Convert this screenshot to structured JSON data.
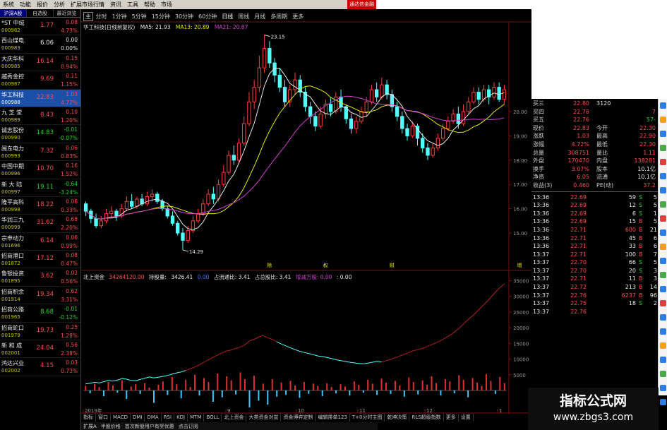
{
  "menu": {
    "items": [
      "系统",
      "功能",
      "报价",
      "分析",
      "扩展市场行情",
      "资讯",
      "工具",
      "帮助",
      "市场"
    ],
    "right_label": "通达信金融"
  },
  "stock_list": {
    "tabs": [
      "沪深A股",
      "自选股",
      "最近浏览"
    ],
    "rows": [
      {
        "name": "*ST 中绒",
        "code": "000982",
        "price": "1.77",
        "change": "0.08",
        "pct": "4.73%",
        "color": "red"
      },
      {
        "name": "西山煤电",
        "code": "000983",
        "price": "6.06",
        "change": "0.00",
        "pct": "0.00%",
        "color": "white"
      },
      {
        "name": "大庆华科",
        "code": "000985",
        "price": "16.14",
        "change": "0.15",
        "pct": "0.94%",
        "color": "red"
      },
      {
        "name": "越秀金控",
        "code": "000987",
        "price": "9.69",
        "change": "0.11",
        "pct": "1.15%",
        "color": "red"
      },
      {
        "name": "华工科技",
        "code": "000988",
        "price": "22.83",
        "change": "1.03",
        "pct": "4.72%",
        "color": "red",
        "selected": true
      },
      {
        "name": "九 芝 堂",
        "code": "000989",
        "price": "8.43",
        "change": "0.10",
        "pct": "1.20%",
        "color": "red"
      },
      {
        "name": "诚志股份",
        "code": "000990",
        "price": "14.83",
        "change": "-0.01",
        "pct": "-0.07%",
        "color": "green"
      },
      {
        "name": "闽东电力",
        "code": "000993",
        "price": "7.32",
        "change": "0.06",
        "pct": "0.83%",
        "color": "red"
      },
      {
        "name": "中国中期",
        "code": "000996",
        "price": "10.70",
        "change": "0.16",
        "pct": "1.52%",
        "color": "red"
      },
      {
        "name": "新 大 陆",
        "code": "000997",
        "price": "19.11",
        "change": "-0.64",
        "pct": "-3.24%",
        "color": "green"
      },
      {
        "name": "隆平高科",
        "code": "000998",
        "price": "18.22",
        "change": "0.06",
        "pct": "0.33%",
        "color": "red"
      },
      {
        "name": "华润三九",
        "code": "000999",
        "price": "31.62",
        "change": "0.68",
        "pct": "2.20%",
        "color": "red"
      },
      {
        "name": "宗申动力",
        "code": "001696",
        "price": "6.14",
        "change": "0.06",
        "pct": "0.99%",
        "color": "red"
      },
      {
        "name": "招商港口",
        "code": "001872",
        "price": "17.12",
        "change": "0.08",
        "pct": "0.47%",
        "color": "red"
      },
      {
        "name": "鲁银投资",
        "code": "001895",
        "price": "3.62",
        "change": "0.02",
        "pct": "0.56%",
        "color": "red"
      },
      {
        "name": "招商积余",
        "code": "001914",
        "price": "19.34",
        "change": "0.62",
        "pct": "3.31%",
        "color": "red"
      },
      {
        "name": "招商公路",
        "code": "001965",
        "price": "8.68",
        "change": "-0.01",
        "pct": "-0.12%",
        "color": "green"
      },
      {
        "name": "招商蛇口",
        "code": "001979",
        "price": "19.73",
        "change": "0.25",
        "pct": "1.28%",
        "color": "red"
      },
      {
        "name": "新 和 成",
        "code": "002001",
        "price": "24.04",
        "change": "0.56",
        "pct": "2.38%",
        "color": "red"
      },
      {
        "name": "鸿达兴业",
        "code": "002002",
        "price": "4.15",
        "change": "0.03",
        "pct": "0.73%",
        "color": "red"
      }
    ]
  },
  "period_bar": {
    "items": [
      "分时",
      "1分钟",
      "5分钟",
      "15分钟",
      "30分钟",
      "60分钟",
      "日线",
      "周线",
      "月线",
      "多周期",
      "更多"
    ],
    "box_label": "主"
  },
  "chart_header": {
    "name": "华工科技(日线前复权)",
    "ma5": "MA5: 21.93",
    "ma13": "MA13: 20.89",
    "ma21": "MA21: 20.87"
  },
  "vol_header": {
    "name": "北上资金",
    "v1": "34264120.00",
    "v2label": "持股量:",
    "v2": "3426.41",
    "v3": "0.00",
    "v4": "占流通比: 3.41",
    "v5": "占总股比: 3.41",
    "v6": "增减万股: 0.00",
    "v7": ": 0.00"
  },
  "chart_data": {
    "type": "candlestick",
    "y_ticks": [
      "20.00",
      "19.00",
      "18.00",
      "17.00",
      "16.00",
      "15.00"
    ],
    "vol_ticks": [
      "35000",
      "30000",
      "25000",
      "20000",
      "15000",
      "10000",
      "5000"
    ],
    "annotations": [
      "23.15",
      "14.29"
    ],
    "markers": [
      "除",
      "权",
      "财",
      "增"
    ],
    "x_labels": [
      "2019年",
      "9",
      "10",
      "11",
      "12",
      "1"
    ],
    "candles": [
      {
        "o": 16.2,
        "c": 15.9,
        "h": 16.3,
        "l": 15.7
      },
      {
        "o": 15.9,
        "c": 15.6,
        "h": 16.0,
        "l": 15.4
      },
      {
        "o": 15.6,
        "c": 15.3,
        "h": 15.8,
        "l": 15.2
      },
      {
        "o": 15.3,
        "c": 15.5,
        "h": 15.7,
        "l": 15.2
      },
      {
        "o": 15.5,
        "c": 15.8,
        "h": 16.0,
        "l": 15.4
      },
      {
        "o": 15.8,
        "c": 15.9,
        "h": 16.1,
        "l": 15.6
      },
      {
        "o": 15.9,
        "c": 15.7,
        "h": 16.0,
        "l": 15.5
      },
      {
        "o": 15.7,
        "c": 16.0,
        "h": 16.2,
        "l": 15.6
      },
      {
        "o": 16.0,
        "c": 16.3,
        "h": 16.5,
        "l": 15.9
      },
      {
        "o": 16.3,
        "c": 16.1,
        "h": 16.6,
        "l": 16.0
      },
      {
        "o": 16.1,
        "c": 16.4,
        "h": 16.5,
        "l": 16.0
      },
      {
        "o": 16.4,
        "c": 16.2,
        "h": 16.6,
        "l": 16.1
      },
      {
        "o": 16.2,
        "c": 16.5,
        "h": 16.7,
        "l": 16.1
      },
      {
        "o": 16.5,
        "c": 16.6,
        "h": 16.8,
        "l": 16.3
      },
      {
        "o": 16.6,
        "c": 16.3,
        "h": 16.7,
        "l": 16.2
      },
      {
        "o": 16.3,
        "c": 16.0,
        "h": 16.4,
        "l": 15.9
      },
      {
        "o": 16.0,
        "c": 15.7,
        "h": 16.1,
        "l": 15.6
      },
      {
        "o": 15.7,
        "c": 15.4,
        "h": 15.9,
        "l": 15.3
      },
      {
        "o": 15.4,
        "c": 15.0,
        "h": 15.5,
        "l": 14.9
      },
      {
        "o": 15.0,
        "c": 14.7,
        "h": 15.2,
        "l": 14.3
      },
      {
        "o": 14.7,
        "c": 15.1,
        "h": 15.3,
        "l": 14.6
      },
      {
        "o": 15.1,
        "c": 15.5,
        "h": 15.7,
        "l": 15.0
      },
      {
        "o": 15.5,
        "c": 15.8,
        "h": 16.0,
        "l": 15.4
      },
      {
        "o": 15.8,
        "c": 16.2,
        "h": 16.4,
        "l": 15.7
      },
      {
        "o": 16.2,
        "c": 16.6,
        "h": 16.8,
        "l": 16.1
      },
      {
        "o": 16.6,
        "c": 16.4,
        "h": 16.9,
        "l": 16.2
      },
      {
        "o": 16.4,
        "c": 17.0,
        "h": 17.2,
        "l": 16.3
      },
      {
        "o": 17.0,
        "c": 17.5,
        "h": 17.8,
        "l": 16.9
      },
      {
        "o": 17.5,
        "c": 18.2,
        "h": 18.4,
        "l": 17.4
      },
      {
        "o": 18.2,
        "c": 18.0,
        "h": 18.6,
        "l": 17.8
      },
      {
        "o": 18.0,
        "c": 18.7,
        "h": 18.9,
        "l": 17.9
      },
      {
        "o": 18.7,
        "c": 19.5,
        "h": 19.8,
        "l": 18.6
      },
      {
        "o": 19.5,
        "c": 20.4,
        "h": 20.8,
        "l": 19.4
      },
      {
        "o": 20.4,
        "c": 21.0,
        "h": 21.3,
        "l": 20.1
      },
      {
        "o": 21.0,
        "c": 21.8,
        "h": 22.3,
        "l": 20.8
      },
      {
        "o": 21.8,
        "c": 22.6,
        "h": 23.15,
        "l": 21.6
      },
      {
        "o": 22.6,
        "c": 22.0,
        "h": 22.9,
        "l": 21.8
      },
      {
        "o": 22.0,
        "c": 21.5,
        "h": 22.2,
        "l": 21.2
      },
      {
        "o": 21.5,
        "c": 21.0,
        "h": 21.8,
        "l": 20.8
      },
      {
        "o": 21.0,
        "c": 20.4,
        "h": 21.3,
        "l": 20.2
      },
      {
        "o": 20.4,
        "c": 20.9,
        "h": 21.1,
        "l": 20.2
      },
      {
        "o": 20.9,
        "c": 21.3,
        "h": 21.6,
        "l": 20.7
      },
      {
        "o": 21.3,
        "c": 20.8,
        "h": 21.5,
        "l": 20.6
      },
      {
        "o": 20.8,
        "c": 20.2,
        "h": 21.0,
        "l": 20.0
      },
      {
        "o": 20.2,
        "c": 19.8,
        "h": 20.4,
        "l": 19.5
      },
      {
        "o": 19.8,
        "c": 19.4,
        "h": 20.0,
        "l": 19.2
      },
      {
        "o": 19.4,
        "c": 19.9,
        "h": 20.2,
        "l": 19.3
      },
      {
        "o": 19.9,
        "c": 20.3,
        "h": 20.5,
        "l": 19.7
      },
      {
        "o": 20.3,
        "c": 20.0,
        "h": 20.6,
        "l": 19.8
      },
      {
        "o": 20.0,
        "c": 20.6,
        "h": 20.8,
        "l": 19.9
      },
      {
        "o": 20.6,
        "c": 20.2,
        "h": 20.9,
        "l": 20.0
      },
      {
        "o": 20.2,
        "c": 19.7,
        "h": 20.3,
        "l": 19.5
      },
      {
        "o": 19.7,
        "c": 19.3,
        "h": 19.9,
        "l": 19.1
      },
      {
        "o": 19.3,
        "c": 19.6,
        "h": 19.8,
        "l": 19.1
      },
      {
        "o": 19.6,
        "c": 20.0,
        "h": 20.2,
        "l": 19.5
      },
      {
        "o": 20.0,
        "c": 20.4,
        "h": 20.6,
        "l": 19.8
      },
      {
        "o": 20.4,
        "c": 20.9,
        "h": 21.1,
        "l": 20.3
      },
      {
        "o": 20.9,
        "c": 20.6,
        "h": 21.2,
        "l": 20.4
      },
      {
        "o": 20.6,
        "c": 21.1,
        "h": 21.4,
        "l": 20.5
      },
      {
        "o": 21.1,
        "c": 20.7,
        "h": 21.3,
        "l": 20.5
      },
      {
        "o": 20.7,
        "c": 20.2,
        "h": 20.9,
        "l": 20.0
      },
      {
        "o": 20.2,
        "c": 19.8,
        "h": 20.4,
        "l": 19.6
      },
      {
        "o": 19.8,
        "c": 19.3,
        "h": 20.0,
        "l": 19.1
      },
      {
        "o": 19.3,
        "c": 19.0,
        "h": 19.5,
        "l": 18.8
      },
      {
        "o": 19.0,
        "c": 19.4,
        "h": 19.6,
        "l": 18.9
      },
      {
        "o": 19.4,
        "c": 18.9,
        "h": 19.5,
        "l": 18.6
      },
      {
        "o": 18.9,
        "c": 18.5,
        "h": 19.1,
        "l": 18.3
      },
      {
        "o": 18.5,
        "c": 18.2,
        "h": 18.7,
        "l": 18.0
      },
      {
        "o": 18.2,
        "c": 18.5,
        "h": 18.7,
        "l": 18.1
      },
      {
        "o": 18.5,
        "c": 18.9,
        "h": 19.1,
        "l": 18.4
      },
      {
        "o": 18.9,
        "c": 19.3,
        "h": 19.5,
        "l": 18.8
      },
      {
        "o": 19.3,
        "c": 19.6,
        "h": 19.8,
        "l": 19.2
      },
      {
        "o": 19.6,
        "c": 19.9,
        "h": 20.1,
        "l": 19.5
      },
      {
        "o": 19.9,
        "c": 19.5,
        "h": 20.2,
        "l": 19.3
      },
      {
        "o": 19.5,
        "c": 20.0,
        "h": 20.3,
        "l": 19.4
      },
      {
        "o": 20.0,
        "c": 20.4,
        "h": 20.6,
        "l": 19.9
      },
      {
        "o": 20.4,
        "c": 20.8,
        "h": 21.0,
        "l": 20.3
      },
      {
        "o": 20.8,
        "c": 20.5,
        "h": 21.0,
        "l": 20.3
      },
      {
        "o": 20.5,
        "c": 20.9,
        "h": 21.1,
        "l": 20.4
      },
      {
        "o": 20.9,
        "c": 20.6,
        "h": 21.1,
        "l": 20.3
      },
      {
        "o": 20.6,
        "c": 21.0,
        "h": 21.2,
        "l": 20.5
      },
      {
        "o": 21.0,
        "c": 20.5,
        "h": 21.2,
        "l": 20.4
      },
      {
        "o": 20.5,
        "c": 20.9,
        "h": 21.1,
        "l": 20.3
      }
    ],
    "flow_line": [
      2.1,
      2.3,
      2.6,
      2.4,
      2.8,
      3.2,
      3.0,
      3.3,
      3.8,
      3.6,
      3.2,
      3.1,
      3.5,
      3.9,
      4.3,
      4.0,
      4.2,
      4.5,
      4.8,
      5.2,
      5.6,
      5.9,
      6.4,
      6.9,
      7.5,
      8.2,
      9.0,
      9.8,
      10.6,
      11.3,
      12.0,
      12.6,
      12.9,
      13.4,
      13.8,
      14.6,
      15.8,
      16.3,
      17.0,
      17.5,
      16.8,
      16.3,
      15.5,
      14.8,
      14.2,
      13.6,
      13.0,
      12.5,
      12.1,
      11.8,
      11.4,
      11.0,
      10.8,
      10.5,
      10.2,
      9.8,
      9.5,
      9.3,
      9.0,
      8.8,
      8.6,
      8.5,
      8.7,
      9.0,
      9.3,
      9.1,
      9.5,
      9.9,
      10.4,
      11.0,
      11.5,
      12.1,
      12.7,
      13.0,
      13.4,
      14.0,
      14.6,
      15.2,
      15.9,
      16.7,
      17.6,
      18.6,
      19.8,
      21.2,
      22.6,
      23.8,
      25.2,
      26.7,
      28.1,
      29.7,
      31.3,
      32.8,
      34.0
    ],
    "flow_bars": [
      0.8,
      -0.5,
      1.2,
      0.6,
      -1.0,
      1.5,
      0.9,
      -0.4,
      1.8,
      -1.5,
      0.7,
      1.1,
      -0.6,
      1.3,
      0.5,
      -2.2,
      1.0,
      1.6,
      -0.8,
      2.4,
      1.1,
      -1.4,
      1.9,
      0.6,
      2.8,
      -0.9,
      2.2,
      1.5,
      -2.0,
      3.0,
      -1.2,
      2.5,
      1.8,
      -0.7,
      3.2,
      2.0,
      -3.0,
      2.6,
      -1.8,
      1.2,
      -2.5,
      2.0,
      -1.1,
      1.4,
      -0.8,
      1.7,
      0.9,
      -1.3,
      1.5,
      -0.6,
      1.2,
      0.8,
      -1.0,
      1.3,
      0.6,
      -0.5,
      1.1,
      0.7,
      -0.9,
      1.6,
      1.0,
      -0.4,
      1.9,
      1.2,
      -0.8,
      2.1,
      1.4,
      -0.6,
      1.7,
      0.9,
      -1.1,
      2.3,
      1.5,
      -0.7,
      1.8,
      1.0,
      2.5,
      1.3,
      -0.9,
      2.0,
      1.6,
      -0.5,
      2.7,
      1.9,
      -1.2,
      2.2,
      1.4,
      0.8,
      2.9,
      1.7,
      -0.6,
      2.4,
      1.3
    ]
  },
  "quote_panel": {
    "rows": [
      {
        "l": "买三",
        "v": "22.80",
        "n": "3120",
        "x": ""
      },
      {
        "l": "买四",
        "v": "22.78",
        "n": "",
        "x": "7"
      },
      {
        "l": "买五",
        "v": "22.76",
        "n": "",
        "x": "-57"
      },
      {
        "l": "现价",
        "v": "22.83",
        "n": "今开",
        "x": "22.30"
      },
      {
        "l": "涨跌",
        "v": "1.03",
        "n": "最高",
        "x": "22.90"
      },
      {
        "l": "涨幅",
        "v": "4.72%",
        "n": "最低",
        "x": "22.30"
      },
      {
        "l": "总量",
        "v": "308751",
        "n": "量比",
        "x": "1.11"
      },
      {
        "l": "外盘",
        "v": "170470",
        "n": "内盘",
        "x": "138281"
      },
      {
        "l": "换手",
        "v": "3.07%",
        "n": "股本",
        "x": "10.1亿"
      },
      {
        "l": "净资",
        "v": "6.05",
        "n": "流通",
        "x": "10.1亿"
      },
      {
        "l": "收益(3)",
        "v": "0.460",
        "n": "PE(动)",
        "x": "37.2"
      }
    ],
    "ticks": [
      {
        "t": "13:36",
        "p": "22.69",
        "v": "59",
        "s": "S",
        "n": "5"
      },
      {
        "t": "13:36",
        "p": "22.69",
        "v": "12",
        "s": "S",
        "n": "5"
      },
      {
        "t": "13:36",
        "p": "22.69",
        "v": "6",
        "s": "S",
        "n": "1"
      },
      {
        "t": "13:36",
        "p": "22.69",
        "v": "15",
        "s": "B",
        "n": "5"
      },
      {
        "t": "13:36",
        "p": "22.71",
        "v": "600",
        "s": "B",
        "n": "21"
      },
      {
        "t": "13:36",
        "p": "22.71",
        "v": "45",
        "s": "B",
        "n": "6"
      },
      {
        "t": "13:36",
        "p": "22.71",
        "v": "33",
        "s": "B",
        "n": "6"
      },
      {
        "t": "13:37",
        "p": "22.71",
        "v": "100",
        "s": "B",
        "n": "7"
      },
      {
        "t": "13:37",
        "p": "22.70",
        "v": "66",
        "s": "S",
        "n": "5"
      },
      {
        "t": "13:37",
        "p": "22.70",
        "v": "20",
        "s": "S",
        "n": "3"
      },
      {
        "t": "13:37",
        "p": "22.71",
        "v": "11",
        "s": "B",
        "n": "3"
      },
      {
        "t": "13:37",
        "p": "22.72",
        "v": "213",
        "s": "B",
        "n": "14"
      },
      {
        "t": "13:37",
        "p": "22.76",
        "v": "6237",
        "s": "B",
        "n": "96"
      },
      {
        "t": "13:37",
        "p": "22.75",
        "v": "18",
        "s": "S",
        "n": "2"
      },
      {
        "t": "13:37",
        "p": "22.76",
        "v": "",
        "s": "",
        "n": ""
      }
    ]
  },
  "bottom_tabs": [
    "指标",
    "窗口",
    "MACD",
    "DMI",
    "DMA",
    "RSI",
    "KDJ",
    "MTM",
    "BOLL",
    "北上资金",
    "大类资金对盆",
    "资金博弈定制",
    "编辑排单123",
    "T+0分时主图",
    "乾坤决策",
    "RLS超级指数",
    "更多",
    "设置"
  ],
  "bottom_tabs2": [
    "扩展A",
    "半股价格",
    "首次新股用户有奖优惠",
    "点击订阅"
  ],
  "right_icons": [
    "#2e7de0",
    "#f0a020",
    "#2e7de0",
    "#4ca84c",
    "#e04040",
    "#2e7de0",
    "#2e7de0",
    "#4ca84c",
    "#e04040",
    "#2e7de0",
    "#f0a020",
    "#2e7de0",
    "#4ca84c",
    "#2e7de0",
    "#e04040",
    "#2e7de0",
    "#2e7de0",
    "#f0a020",
    "#2e7de0",
    "#4ca84c",
    "#2e7de0",
    "#2e7de0"
  ],
  "watermark": {
    "line1": "指标公式网",
    "line2": "www.zbgs3.com"
  }
}
